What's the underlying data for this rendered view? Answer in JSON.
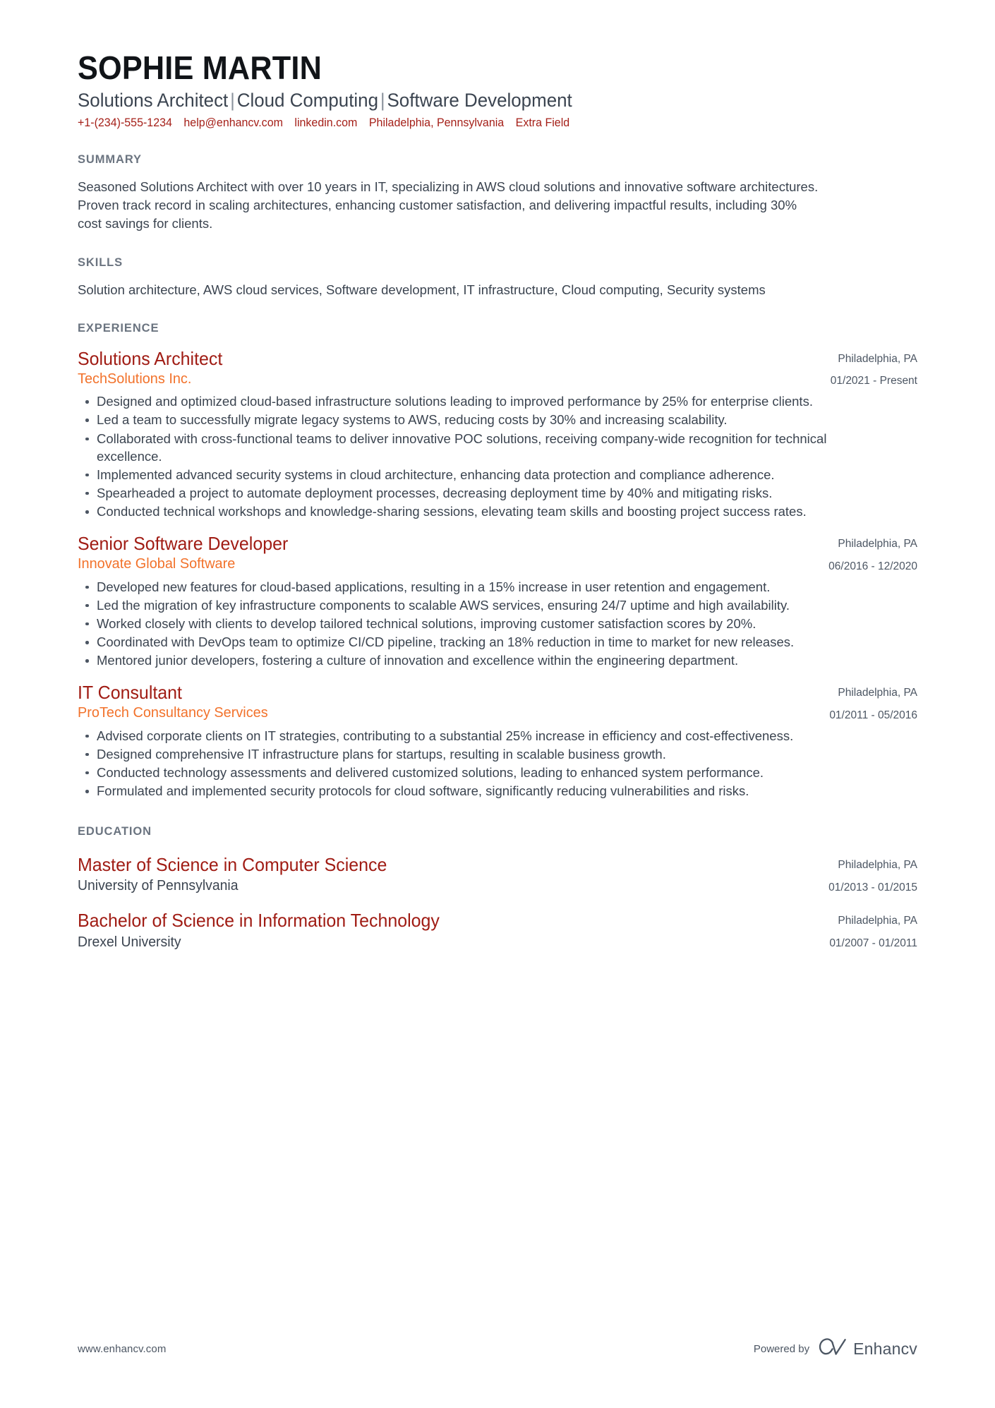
{
  "header": {
    "name": "SOPHIE MARTIN",
    "headline_parts": [
      "Solutions Architect",
      "Cloud Computing",
      "Software Development"
    ],
    "headline_separator": "|",
    "contacts": [
      {
        "name": "phone",
        "text": "+1-(234)-555-1234"
      },
      {
        "name": "email",
        "text": "help@enhancv.com"
      },
      {
        "name": "linkedin",
        "text": "linkedin.com"
      },
      {
        "name": "location",
        "text": "Philadelphia, Pennsylvania"
      },
      {
        "name": "extra-field",
        "text": "Extra Field"
      }
    ]
  },
  "summary": {
    "title": "SUMMARY",
    "text": "Seasoned Solutions Architect with over 10 years in IT, specializing in AWS cloud solutions and innovative software architectures. Proven track record in scaling architectures, enhancing customer satisfaction, and delivering impactful results, including 30% cost savings for clients."
  },
  "skills": {
    "title": "SKILLS",
    "text": "Solution architecture, AWS cloud services, Software development, IT infrastructure, Cloud computing, Security systems"
  },
  "experience": {
    "title": "EXPERIENCE",
    "entries": [
      {
        "role": "Solutions Architect",
        "company": "TechSolutions Inc.",
        "location": "Philadelphia, PA",
        "dates": "01/2021 - Present",
        "bullets": [
          "Designed and optimized cloud-based infrastructure solutions leading to improved performance by 25% for enterprise clients.",
          "Led a team to successfully migrate legacy systems to AWS, reducing costs by 30% and increasing scalability.",
          "Collaborated with cross-functional teams to deliver innovative POC solutions, receiving company-wide recognition for technical excellence.",
          "Implemented advanced security systems in cloud architecture, enhancing data protection and compliance adherence.",
          "Spearheaded a project to automate deployment processes, decreasing deployment time by 40% and mitigating risks.",
          "Conducted technical workshops and knowledge-sharing sessions, elevating team skills and boosting project success rates."
        ]
      },
      {
        "role": "Senior Software Developer",
        "company": "Innovate Global Software",
        "location": "Philadelphia, PA",
        "dates": "06/2016 - 12/2020",
        "bullets": [
          "Developed new features for cloud-based applications, resulting in a 15% increase in user retention and engagement.",
          "Led the migration of key infrastructure components to scalable AWS services, ensuring 24/7 uptime and high availability.",
          "Worked closely with clients to develop tailored technical solutions, improving customer satisfaction scores by 20%.",
          "Coordinated with DevOps team to optimize CI/CD pipeline, tracking an 18% reduction in time to market for new releases.",
          "Mentored junior developers, fostering a culture of innovation and excellence within the engineering department."
        ]
      },
      {
        "role": "IT Consultant",
        "company": "ProTech Consultancy Services",
        "location": "Philadelphia, PA",
        "dates": "01/2011 - 05/2016",
        "bullets": [
          "Advised corporate clients on IT strategies, contributing to a substantial 25% increase in efficiency and cost-effectiveness.",
          "Designed comprehensive IT infrastructure plans for startups, resulting in scalable business growth.",
          "Conducted technology assessments and delivered customized solutions, leading to enhanced system performance.",
          "Formulated and implemented security protocols for cloud software, significantly reducing vulnerabilities and risks."
        ]
      }
    ]
  },
  "education": {
    "title": "EDUCATION",
    "entries": [
      {
        "degree": "Master of Science in Computer Science",
        "school": "University of Pennsylvania",
        "location": "Philadelphia, PA",
        "dates": "01/2013 - 01/2015"
      },
      {
        "degree": "Bachelor of Science in Information Technology",
        "school": "Drexel University",
        "location": "Philadelphia, PA",
        "dates": "01/2007 - 01/2011"
      }
    ]
  },
  "footer": {
    "url": "www.enhancv.com",
    "powered_by": "Powered by",
    "brand": "Enhancv"
  },
  "colors": {
    "name": "#111418",
    "headline": "#3b4450",
    "contact_link": "#a52019",
    "section_title": "#6b7480",
    "role": "#a01c14",
    "company": "#f2722b",
    "body": "#3b4450",
    "meta": "#4c5663",
    "page_background": "#ffffff"
  }
}
